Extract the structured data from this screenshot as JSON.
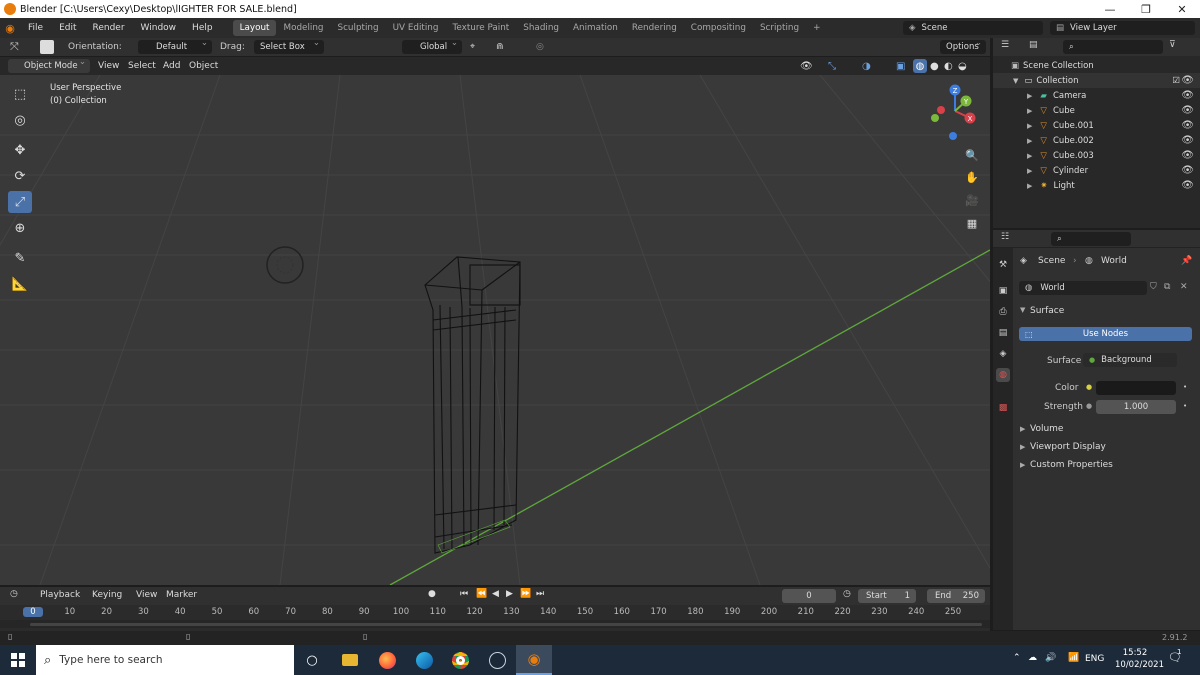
{
  "window": {
    "title": "Blender [C:\\Users\\Cexy\\Desktop\\lIGHTER FOR SALE.blend]",
    "minimize": "—",
    "maximize": "❐",
    "close": "✕"
  },
  "menu": {
    "items": [
      "File",
      "Edit",
      "Render",
      "Window",
      "Help"
    ]
  },
  "workspaces": [
    "Layout",
    "Modeling",
    "Sculpting",
    "UV Editing",
    "Texture Paint",
    "Shading",
    "Animation",
    "Rendering",
    "Compositing",
    "Scripting"
  ],
  "active_workspace": "Layout",
  "add_workspace": "+",
  "scene": {
    "name": "Scene",
    "view_layer": "View Layer"
  },
  "tool_header": {
    "orientation_label": "Orientation:",
    "orientation_value": "Default",
    "drag_label": "Drag:",
    "drag_value": "Select Box",
    "transform_orientation": "Global",
    "options": "Options"
  },
  "viewport_header": {
    "mode": "Object Mode",
    "menus": [
      "View",
      "Select",
      "Add",
      "Object"
    ]
  },
  "viewport": {
    "perspective": "User Perspective",
    "collection": "(0) Collection"
  },
  "gizmo": {
    "x": "X",
    "y": "Y",
    "z": "Z"
  },
  "outliner": {
    "root": "Scene Collection",
    "collection": "Collection",
    "items": [
      {
        "name": "Camera",
        "icon": "camera-icon"
      },
      {
        "name": "Cube",
        "icon": "mesh-icon"
      },
      {
        "name": "Cube.001",
        "icon": "mesh-icon"
      },
      {
        "name": "Cube.002",
        "icon": "mesh-icon"
      },
      {
        "name": "Cube.003",
        "icon": "mesh-icon"
      },
      {
        "name": "Cylinder",
        "icon": "mesh-icon"
      },
      {
        "name": "Light",
        "icon": "light-icon"
      }
    ]
  },
  "properties": {
    "breadcrumb_scene": "Scene",
    "breadcrumb_world": "World",
    "world_name": "World",
    "surface_panel": "Surface",
    "use_nodes": "Use Nodes",
    "surface_label": "Surface",
    "surface_value": "Background",
    "color_label": "Color",
    "strength_label": "Strength",
    "strength_value": "1.000",
    "panels": [
      "Volume",
      "Viewport Display",
      "Custom Properties"
    ]
  },
  "timeline": {
    "menus": [
      "Playback",
      "Keying",
      "View",
      "Marker"
    ],
    "current_frame": "0",
    "start_label": "Start",
    "start_value": "1",
    "end_label": "End",
    "end_value": "250",
    "ticks": [
      "0",
      "10",
      "20",
      "30",
      "40",
      "50",
      "60",
      "70",
      "80",
      "90",
      "100",
      "110",
      "120",
      "130",
      "140",
      "150",
      "160",
      "170",
      "180",
      "190",
      "200",
      "210",
      "220",
      "230",
      "240",
      "250"
    ]
  },
  "status": {
    "version": "2.91.2"
  },
  "taskbar": {
    "search_placeholder": "Type here to search",
    "language": "ENG",
    "time": "15:52",
    "date": "10/02/2021",
    "notifications": "1"
  },
  "colors": {
    "accent": "#4a71a8",
    "orange": "#e87d0d",
    "grid_green": "#5fa83c",
    "grid_red": "#b03a3a",
    "taskbar": "#1c2a3a"
  }
}
